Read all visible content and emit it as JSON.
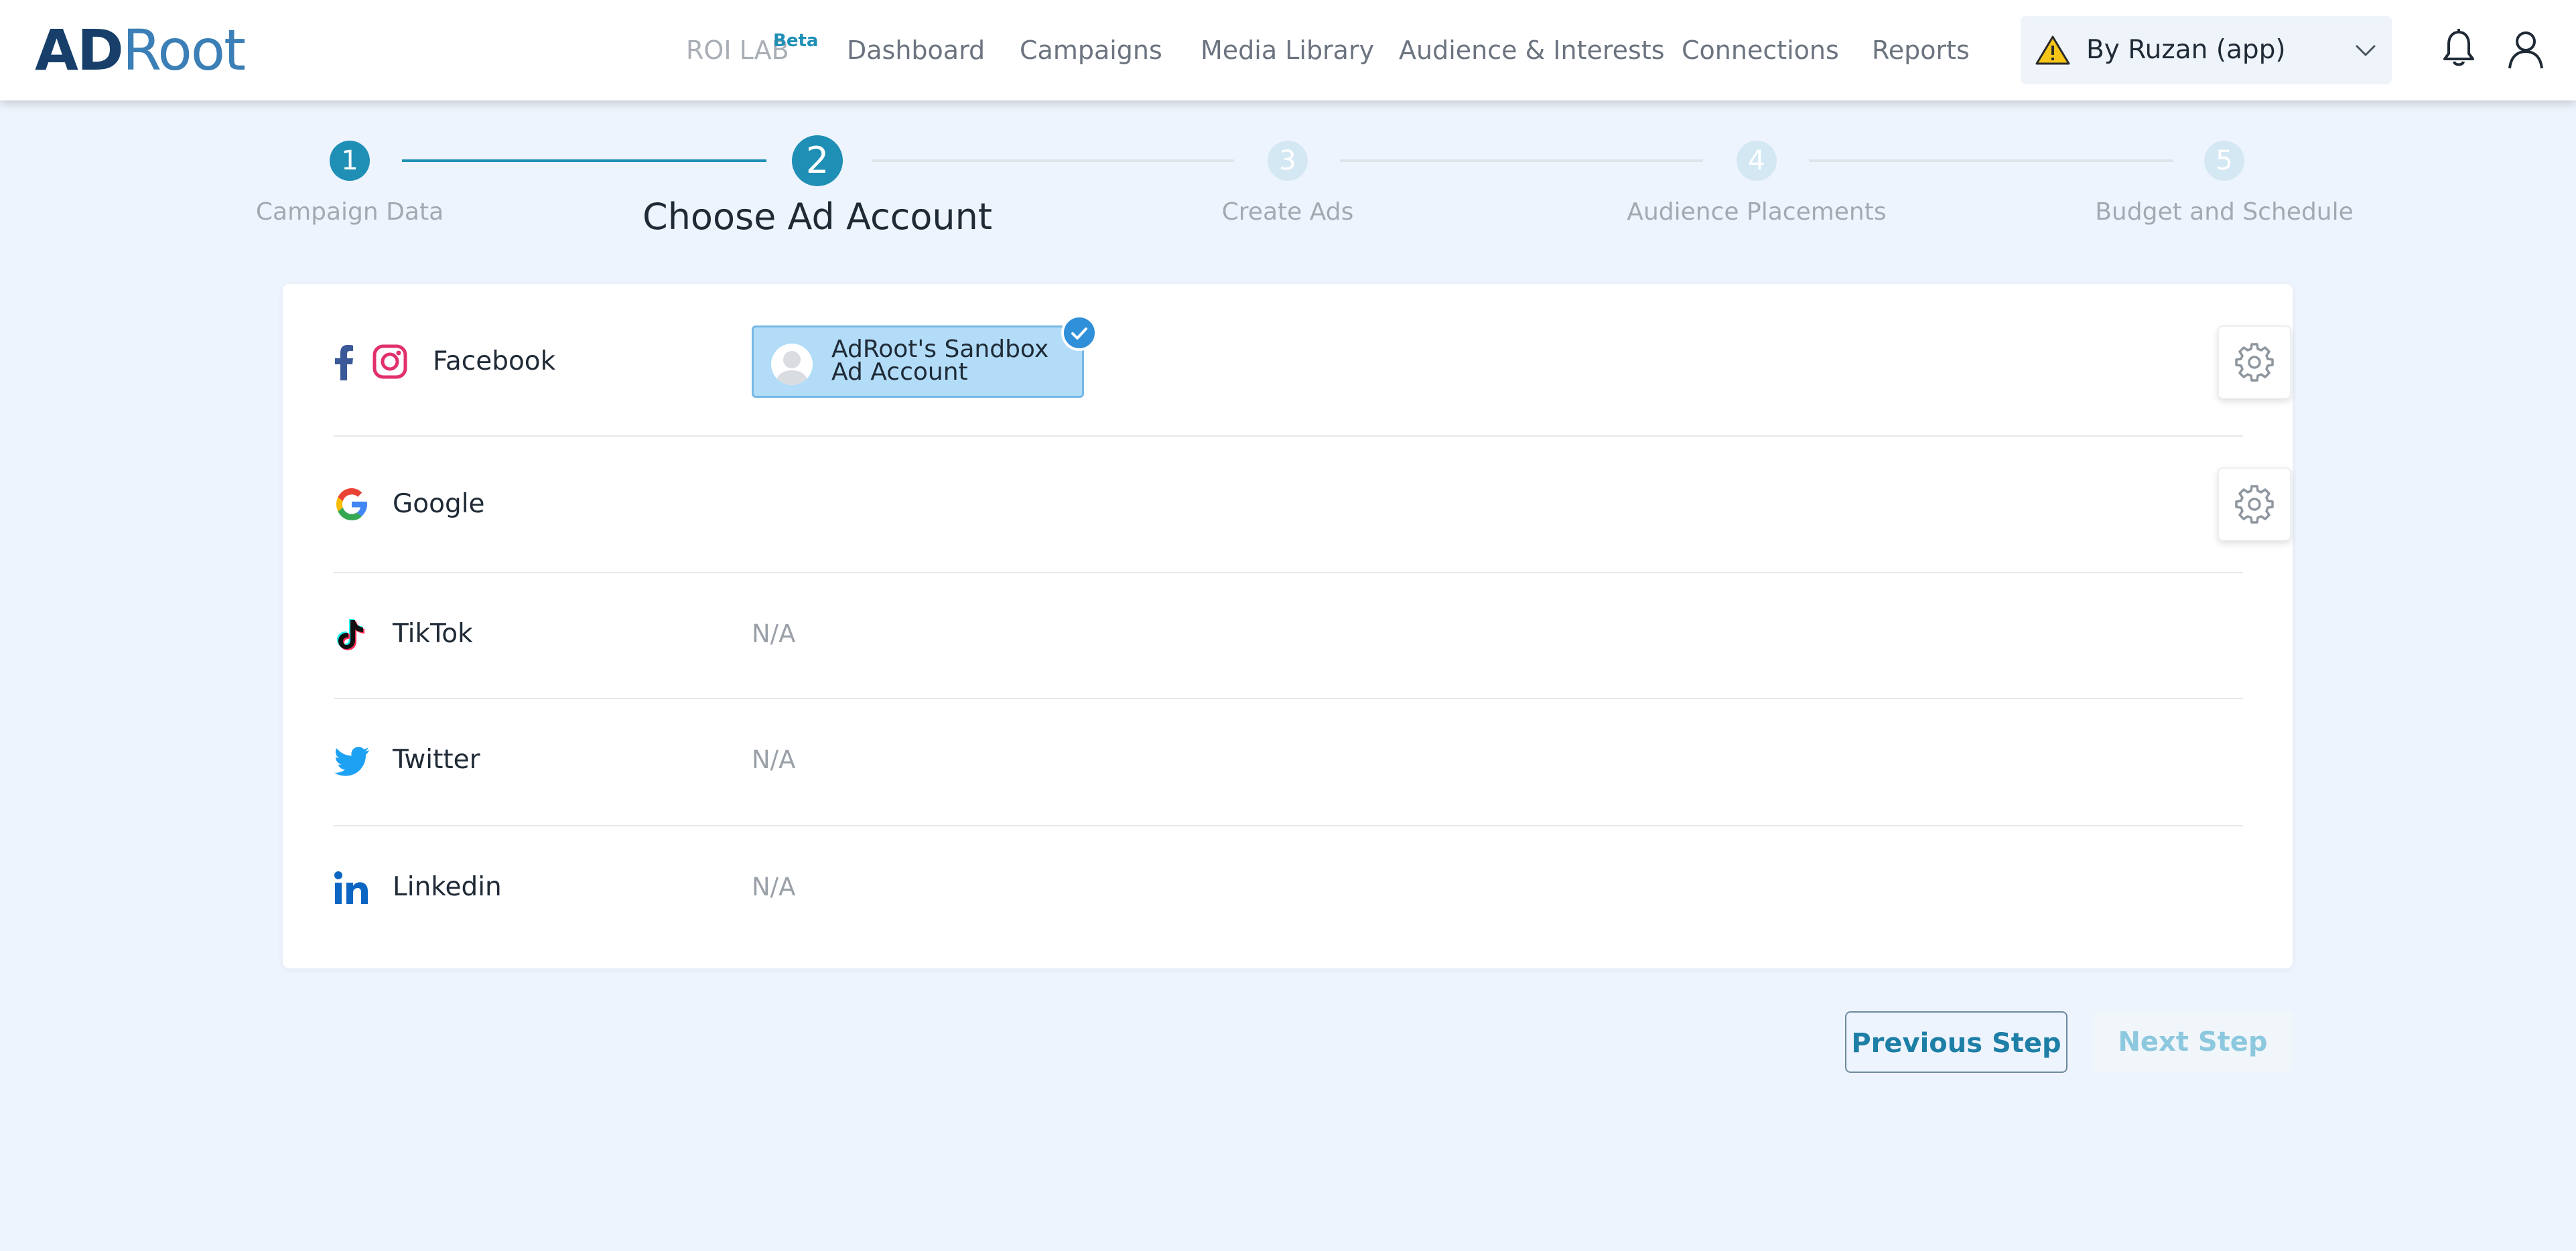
{
  "brand": {
    "logo_ad": "AD",
    "logo_root": "Root"
  },
  "nav": {
    "roi_lab": "ROI LAB",
    "roi_badge": "Beta",
    "items": [
      "Dashboard",
      "Campaigns",
      "Media Library",
      "Audience & Interests",
      "Connections",
      "Reports"
    ]
  },
  "account_selector": {
    "label": "By Ruzan (app)",
    "status_icon": "warning-icon"
  },
  "header_icons": [
    "bell-icon",
    "user-icon"
  ],
  "stepper": {
    "current_step": 2,
    "steps": [
      {
        "number": "1",
        "label": "Campaign Data",
        "state": "done"
      },
      {
        "number": "2",
        "label": "Choose Ad Account",
        "state": "current"
      },
      {
        "number": "3",
        "label": "Create Ads",
        "state": "todo"
      },
      {
        "number": "4",
        "label": "Audience Placements",
        "state": "todo"
      },
      {
        "number": "5",
        "label": "Budget and Schedule",
        "state": "todo"
      }
    ]
  },
  "platforms": [
    {
      "name": "Facebook",
      "icons": [
        "facebook-icon",
        "instagram-icon"
      ],
      "account": "AdRoot's Sandbox Ad Account",
      "selected": true,
      "settings": true
    },
    {
      "name": "Google",
      "icons": [
        "google-icon"
      ],
      "settings": true
    },
    {
      "name": "TikTok",
      "icons": [
        "tiktok-icon"
      ],
      "value": "N/A"
    },
    {
      "name": "Twitter",
      "icons": [
        "twitter-icon"
      ],
      "value": "N/A"
    },
    {
      "name": "Linkedin",
      "icons": [
        "linkedin-icon"
      ],
      "value": "N/A"
    }
  ],
  "footer": {
    "previous_label": "Previous Step",
    "next_label": "Next Step",
    "next_enabled": false
  },
  "colors": {
    "primary": "#1f8fb5",
    "background": "#eef4fd",
    "chip": "#b2dcf7",
    "check": "#2f8fd8"
  }
}
